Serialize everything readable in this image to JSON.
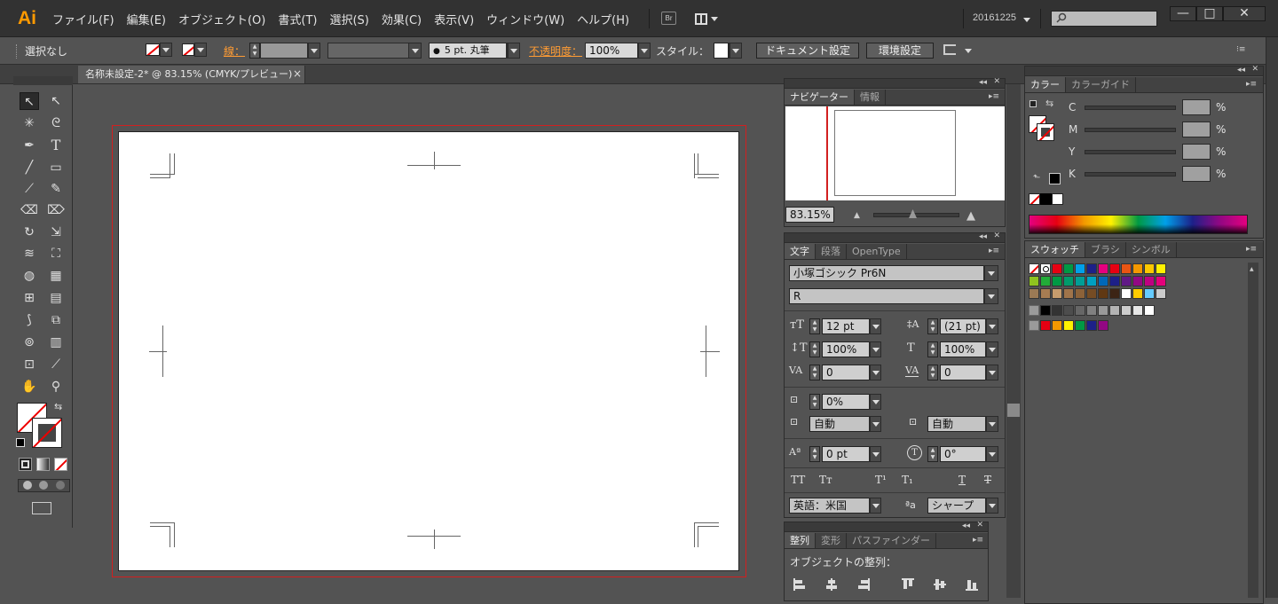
{
  "app": {
    "logo": "Ai"
  },
  "menu": [
    "ファイル(F)",
    "編集(E)",
    "オブジェクト(O)",
    "書式(T)",
    "選択(S)",
    "効果(C)",
    "表示(V)",
    "ウィンドウ(W)",
    "ヘルプ(H)"
  ],
  "topbar": {
    "bridge_label": "Br",
    "workspace": "20161225",
    "window_minimize": "—",
    "window_restore": "□",
    "window_close": "✕"
  },
  "control": {
    "selection": "選択なし",
    "stroke_label": "線：",
    "brush": "5 pt. 丸筆",
    "opacity_label": "不透明度：",
    "opacity_value": "100%",
    "style_label": "スタイル：",
    "doc_settings": "ドキュメント設定",
    "prefs": "環境設定"
  },
  "document": {
    "tab_title": "名称未設定-2* @ 83.15% (CMYK/プレビュー)",
    "tab_close": "×"
  },
  "navigator": {
    "tabs": [
      "ナビゲーター",
      "情報"
    ],
    "zoom": "83.15%"
  },
  "color": {
    "tabs": [
      "カラー",
      "カラーガイド"
    ],
    "channels": [
      {
        "label": "C",
        "unit": "%"
      },
      {
        "label": "M",
        "unit": "%"
      },
      {
        "label": "Y",
        "unit": "%"
      },
      {
        "label": "K",
        "unit": "%"
      }
    ]
  },
  "character": {
    "tabs": [
      "文字",
      "段落",
      "OpenType"
    ],
    "font_family": "小塚ゴシック Pr6N",
    "font_style": "R",
    "size": "12 pt",
    "leading": "(21 pt)",
    "vscale": "100%",
    "hscale": "100%",
    "kerning": "0",
    "tracking": "0",
    "tsume": "0%",
    "aki_left": "自動",
    "aki_right": "自動",
    "baseline": "0 pt",
    "rotation": "0°",
    "language": "英語：米国",
    "antialias": "シャープ",
    "style_buttons": [
      "TT",
      "Tт",
      "T¹",
      "T₁",
      "T",
      "T"
    ]
  },
  "swatches": {
    "tabs": [
      "スウォッチ",
      "ブラシ",
      "シンボル"
    ]
  },
  "align": {
    "tabs": [
      "整列",
      "変形",
      "パスファインダー"
    ],
    "heading": "オブジェクトの整列："
  },
  "colors": {
    "accent": "#ff9a00",
    "artboard_border": "#d21f1f",
    "panel_bg": "#535353",
    "menubar_bg": "#323232"
  }
}
